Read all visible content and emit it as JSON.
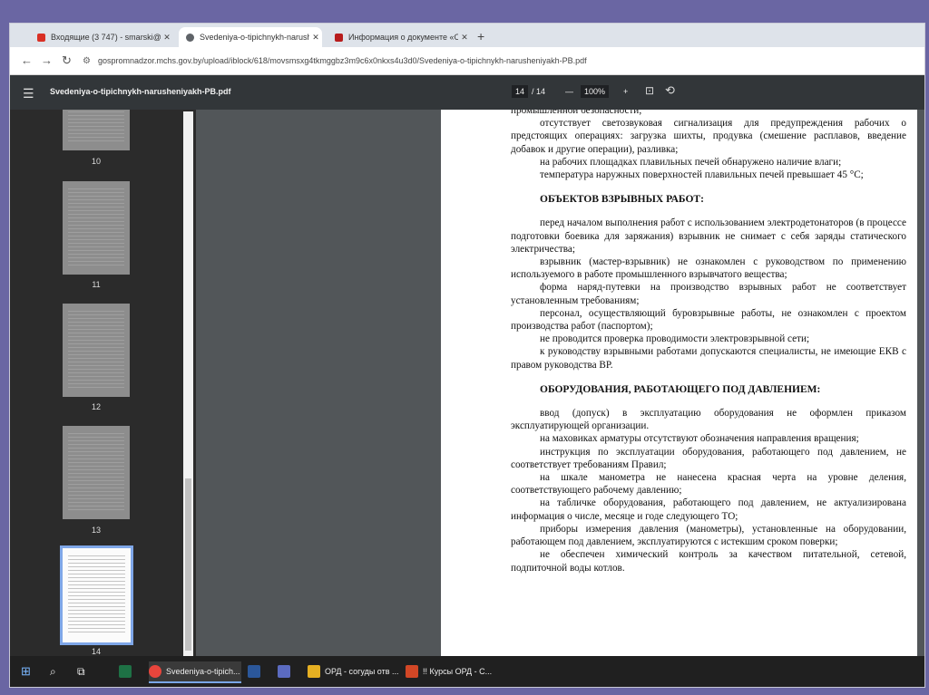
{
  "browser": {
    "tabs": [
      {
        "label": "Входящие (3 747) - smarski@...",
        "icon": "gmail-icon",
        "color": "#d93025"
      },
      {
        "label": "Svedeniya-o-tipichnykh-narush",
        "icon": "globe-icon",
        "color": "#5f6368"
      },
      {
        "label": "Информация о документе «О...",
        "icon": "doc-icon",
        "color": "#b71c1c"
      }
    ],
    "url": "gospromnadzor.mchs.gov.by/upload/iblock/618/movsmsxg4tkmggbz3m9c6x0nkxs4u3d0/Svedeniya-o-tipichnykh-narusheniyakh-PB.pdf"
  },
  "pdf": {
    "filename": "Svedeniya-o-tipichnykh-narusheniyakh-PB.pdf",
    "page_current": "14",
    "page_total": "/ 14",
    "zoom": "100%"
  },
  "thumbnails": [
    "10",
    "11",
    "12",
    "13",
    "14"
  ],
  "doc": {
    "top_fragment": "промышленной безопасности;",
    "sec1_items": [
      "отсутствует светозвуковая сигнализация для предупреждения рабочих о предстоящих операциях: загрузка шихты, продувка (смешение расплавов, введение добавок и другие операции), разливка;",
      "на рабочих площадках плавильных печей обнаружено наличие влаги;",
      "температура наружных поверхностей плавильных печей превышает 45 °С;"
    ],
    "sec2_title": "ОБЪЕКТОВ ВЗРЫВНЫХ РАБОТ:",
    "sec2_items": [
      "перед началом выполнения работ с использованием электродетонаторов (в процессе подготовки боевика для заряжания) взрывник не снимает с себя заряды статического электричества;",
      "взрывник (мастер-взрывник) не ознакомлен с руководством по применению используемого в работе промышленного взрывчатого вещества;",
      "форма наряд-путевки на производство взрывных работ не соответствует установленным требованиям;",
      "персонал, осуществляющий буровзрывные работы, не ознакомлен с проектом производства работ (паспортом);",
      "не проводится проверка проводимости электровзрывной сети;",
      "к руководству взрывными работами допускаются специалисты, не имеющие ЕКВ с правом руководства ВР."
    ],
    "sec3_title": "ОБОРУДОВАНИЯ, РАБОТАЮЩЕГО ПОД ДАВЛЕНИЕМ:",
    "sec3_items": [
      "ввод (допуск) в эксплуатацию оборудования не оформлен приказом эксплуатирующей организации.",
      "на маховиках арматуры отсутствуют обозначения направления вращения;",
      "инструкция по эксплуатации оборудования, работающего под давлением, не соответствует требованиям Правил;",
      "на шкале манометра не нанесена красная черта на уровне деления, соответствующего рабочему давлению;",
      "на табличке оборудования, работающего под давлением, не актуализирована информация о числе, месяце и годе следующего ТО;",
      "приборы измерения давления (манометры), установленные на оборудовании, работающем под давлением, эксплуатируются с истекшим сроком поверки;",
      "не обеспечен химический контроль за качеством питательной, сетевой, подпиточной воды котлов."
    ]
  },
  "taskbar": [
    {
      "label": "",
      "icon": "windows-start-icon"
    },
    {
      "label": "",
      "icon": "search-icon"
    },
    {
      "label": "",
      "icon": "task-view-icon"
    },
    {
      "label": "",
      "icon": "excel-icon",
      "color": "#1e7145"
    },
    {
      "label": "Svedeniya-o-tipich...",
      "icon": "chrome-icon",
      "color": "#e8453c"
    },
    {
      "label": "",
      "icon": "word-icon",
      "color": "#2b579a"
    },
    {
      "label": "",
      "icon": "floppy-icon",
      "color": "#5b6bc0"
    },
    {
      "label": "ОРД - согуды отв ...",
      "icon": "folder-icon",
      "color": "#e6b022"
    },
    {
      "label": "!! Курсы ОРД - С...",
      "icon": "powerpoint-icon",
      "color": "#d24726"
    }
  ]
}
